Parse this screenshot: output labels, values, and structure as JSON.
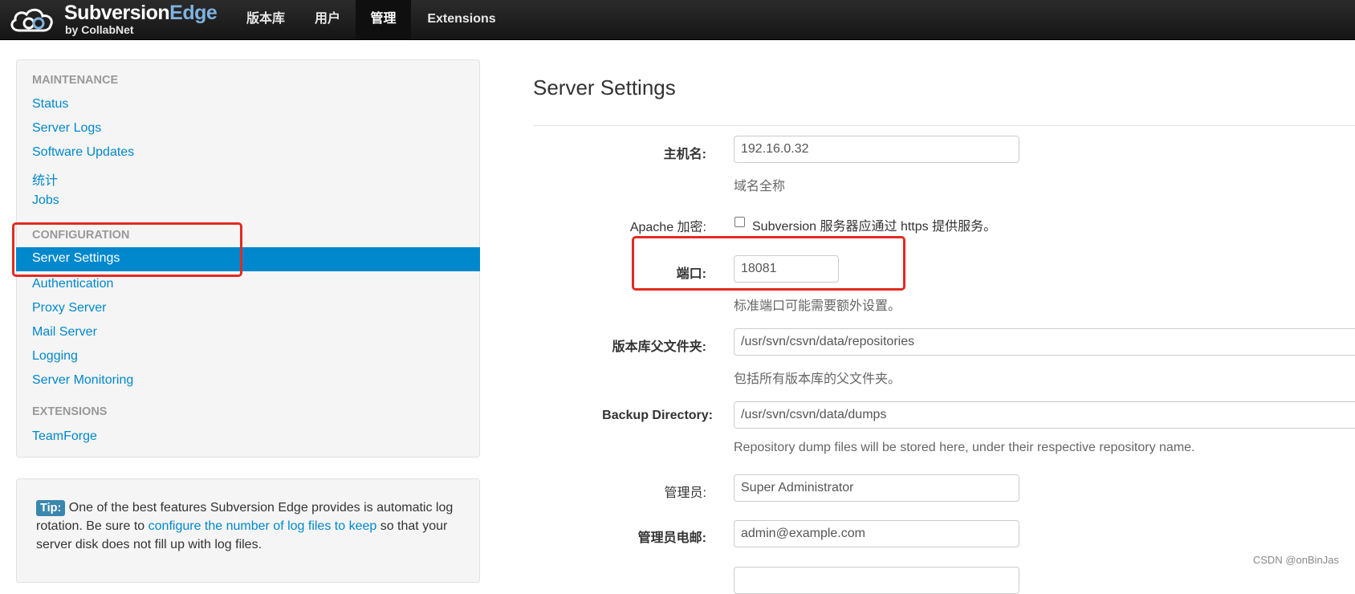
{
  "brand": {
    "name_main": "Subversion",
    "name_accent": "Edge",
    "subtitle": "by CollabNet"
  },
  "nav": [
    "版本库",
    "用户",
    "管理",
    "Extensions"
  ],
  "sidebar": {
    "maintenance_header": "MAINTENANCE",
    "maintenance_items": [
      "Status",
      "Server Logs",
      "Software Updates",
      "统计",
      "Jobs"
    ],
    "configuration_header": "CONFIGURATION",
    "active_item": "Server Settings",
    "configuration_items": [
      "Authentication",
      "Proxy Server",
      "Mail Server",
      "Logging",
      "Server Monitoring"
    ],
    "extensions_header": "EXTENSIONS",
    "extensions_items": [
      "TeamForge"
    ]
  },
  "tip": {
    "badge": "Tip:",
    "text_before": " One of the best features Subversion Edge provides is automatic log rotation. Be sure to ",
    "link": "configure the number of log files to keep",
    "text_after": " so that your server disk does not fill up with log files."
  },
  "page": {
    "title": "Server Settings",
    "hostname_label": "主机名:",
    "hostname_value": "192.16.0.32",
    "hostname_help": "域名全称",
    "apache_label": "Apache 加密:",
    "apache_checkbox_label": "Subversion 服务器应通过 https 提供服务。",
    "port_label": "端口:",
    "port_value": "18081",
    "port_help": "标准端口可能需要额外设置。",
    "repo_parent_label": "版本库父文件夹:",
    "repo_parent_value": "/usr/svn/csvn/data/repositories",
    "repo_parent_help": "包括所有版本库的父文件夹。",
    "backup_label": "Backup Directory:",
    "backup_value": "/usr/svn/csvn/data/dumps",
    "backup_help": "Repository dump files will be stored here, under their respective repository name.",
    "admin_label": "管理员:",
    "admin_value": "Super Administrator",
    "admin_email_label": "管理员电邮:",
    "admin_email_value": "admin@example.com"
  },
  "watermark": "CSDN @onBinJas",
  "colors": {
    "accent": "#0088cc",
    "highlight_box": "#e32a22",
    "navbar": "#1b1b1b"
  }
}
